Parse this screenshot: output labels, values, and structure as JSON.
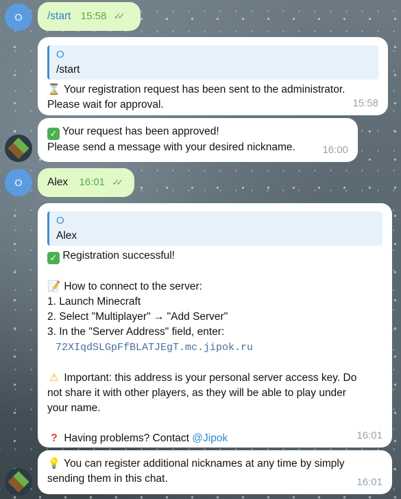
{
  "avatars": {
    "user_letter": "O"
  },
  "msg1": {
    "text": "/start",
    "time": "15:58",
    "ticks": "✓✓"
  },
  "msg2": {
    "quote_name": "O",
    "quote_text": "/start",
    "line1": "Your registration request has been sent to the administrator.",
    "line2": "Please wait for approval.",
    "time": "15:58"
  },
  "msg3": {
    "line1": "Your request has been approved!",
    "line2": "Please send a message with your desired nickname.",
    "time": "16:00"
  },
  "msg4": {
    "text": "Alex",
    "time": "16:01",
    "ticks": "✓✓"
  },
  "msg5": {
    "quote_name": "O",
    "quote_text": "Alex",
    "success": "Registration successful!",
    "howto": "How to connect to the server:",
    "step1": "1. Launch Minecraft",
    "step2": "2. Select \"Multiplayer\" → \"Add Server\"",
    "step3": "3. In the \"Server Address\" field, enter:",
    "address": "72XIqdSLGpFfBLATJEgT.mc.jipok.ru",
    "important1": "Important: this address is your personal server access key. Do",
    "important2": "not share it with other players, as they will be able to play under",
    "important3": "your name.",
    "problems": "Having problems? Contact",
    "contact": "@Jipok",
    "time": "16:01"
  },
  "msg6": {
    "line1": "You can register additional nicknames at any time by simply",
    "line2": "sending them in this chat.",
    "time": "16:01"
  }
}
